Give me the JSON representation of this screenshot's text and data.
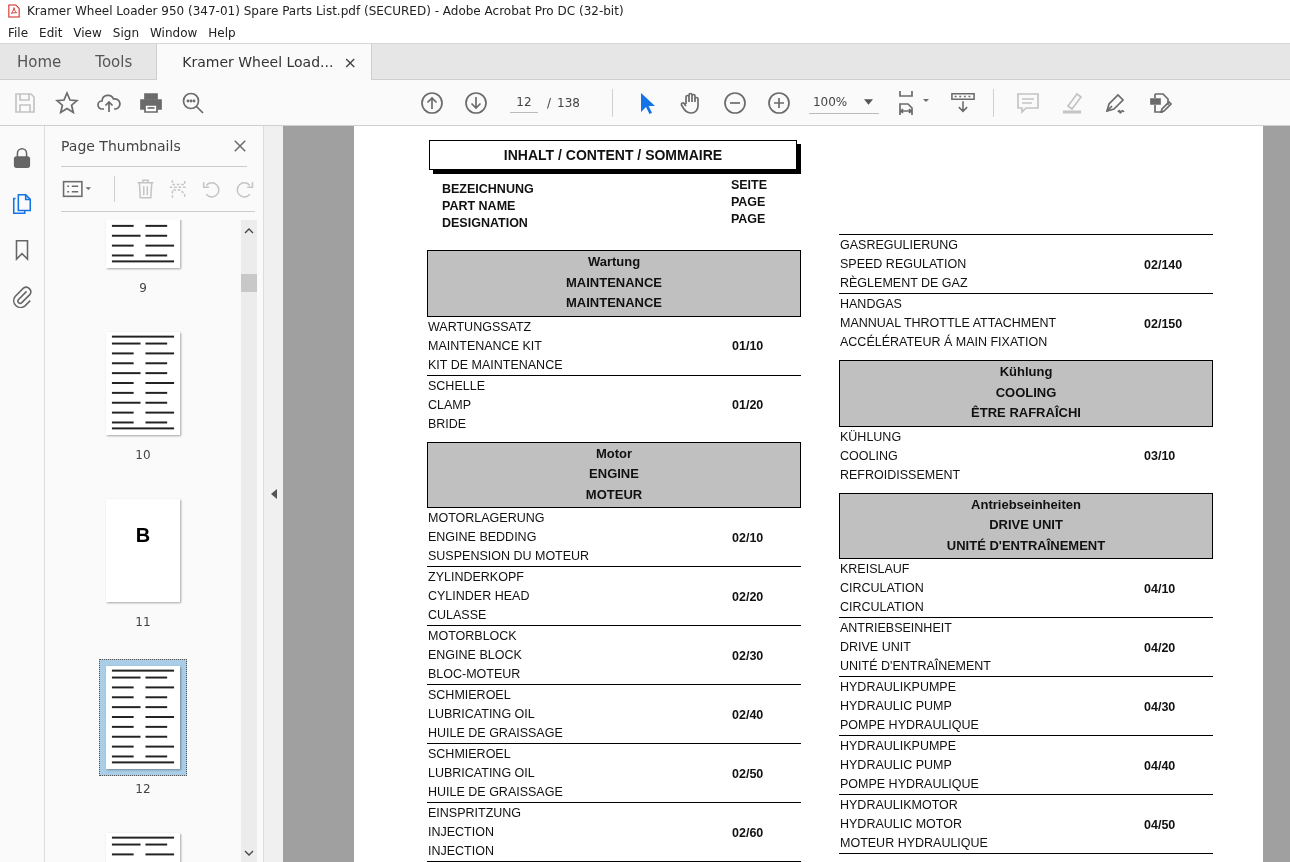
{
  "window": {
    "title": "Kramer Wheel Loader 950 (347-01) Spare Parts List.pdf (SECURED) - Adobe Acrobat Pro DC (32-bit)"
  },
  "menu": [
    "File",
    "Edit",
    "View",
    "Sign",
    "Window",
    "Help"
  ],
  "tabs": [
    {
      "label": "Home",
      "selected": false
    },
    {
      "label": "Tools",
      "selected": false
    },
    {
      "label": "Kramer Wheel Load...",
      "selected": true,
      "close": "×"
    }
  ],
  "toolbar": {
    "left_tools": [
      {
        "kind": "save",
        "disabled": true
      },
      {
        "kind": "star",
        "disabled": false
      },
      {
        "kind": "upload",
        "disabled": false
      },
      {
        "kind": "print",
        "disabled": false
      },
      {
        "kind": "find",
        "disabled": false
      }
    ],
    "page_current": "12",
    "page_separator": "/",
    "page_total": "138",
    "tools": [
      {
        "kind": "pointer",
        "selected": true
      },
      {
        "kind": "hand",
        "selected": false
      }
    ],
    "zoom": "100%",
    "right_tools": [
      {
        "kind": "comment",
        "disabled": true
      },
      {
        "kind": "highlight",
        "disabled": true
      },
      {
        "kind": "sign",
        "disabled": false
      },
      {
        "kind": "form",
        "disabled": false
      }
    ]
  },
  "rail": [
    {
      "kind": "lock",
      "selected": false
    },
    {
      "kind": "pages",
      "selected": true
    },
    {
      "kind": "bookmark",
      "selected": false
    },
    {
      "kind": "attachment",
      "selected": false
    }
  ],
  "panel": {
    "title": "Page Thumbnails",
    "tools": [
      {
        "kind": "delete",
        "disabled": true
      },
      {
        "kind": "insert",
        "disabled": true
      },
      {
        "kind": "rotate_left",
        "disabled": true
      },
      {
        "kind": "rotate_right",
        "disabled": true
      }
    ],
    "thumbnails": [
      {
        "label": "9",
        "selected": false
      },
      {
        "label": "10",
        "selected": false
      },
      {
        "label": "11",
        "selected": false,
        "letter": "B"
      },
      {
        "label": "12",
        "selected": true
      },
      {
        "selected": false
      }
    ]
  },
  "document": {
    "title": "INHALT / CONTENT / SOMMAIRE",
    "name_labels": [
      "BEZEICHNUNG",
      "PART NAME",
      "DESIGNATION"
    ],
    "page_labels": [
      "SEITE",
      "PAGE",
      "PAGE"
    ],
    "left_column": [
      {
        "kind": "section",
        "lines": [
          "Wartung",
          "MAINTENANCE",
          "MAINTENANCE"
        ]
      },
      {
        "kind": "entry",
        "lines": [
          "WARTUNGSSATZ",
          "MAINTENANCE KIT",
          "KIT DE MAINTENANCE"
        ],
        "page": "01/10"
      },
      {
        "kind": "entry",
        "lines": [
          "SCHELLE",
          "CLAMP",
          "BRIDE"
        ],
        "page": "01/20"
      },
      {
        "kind": "section",
        "lines": [
          "Motor",
          "ENGINE",
          "MOTEUR"
        ]
      },
      {
        "kind": "entry",
        "lines": [
          "MOTORLAGERUNG",
          "ENGINE BEDDING",
          "SUSPENSION DU MOTEUR"
        ],
        "page": "02/10"
      },
      {
        "kind": "entry",
        "lines": [
          "ZYLINDERKOPF",
          "CYLINDER HEAD",
          "CULASSE"
        ],
        "page": "02/20"
      },
      {
        "kind": "entry",
        "lines": [
          "MOTORBLOCK",
          "ENGINE BLOCK",
          "BLOC-MOTEUR"
        ],
        "page": "02/30"
      },
      {
        "kind": "entry",
        "lines": [
          "SCHMIEROEL",
          "LUBRICATING OIL",
          "HUILE DE GRAISSAGE"
        ],
        "page": "02/40"
      },
      {
        "kind": "entry",
        "lines": [
          "SCHMIEROEL",
          "LUBRICATING OIL",
          "HUILE DE GRAISSAGE"
        ],
        "page": "02/50"
      },
      {
        "kind": "entry",
        "lines": [
          "EINSPRITZUNG",
          "INJECTION",
          "INJECTION"
        ],
        "page": "02/60"
      }
    ],
    "right_column": [
      {
        "kind": "entry",
        "lines": [
          "GASREGULIERUNG",
          "SPEED REGULATION",
          "RÈGLEMENT DE GAZ"
        ],
        "page": "02/140"
      },
      {
        "kind": "entry",
        "lines": [
          "HANDGAS",
          "MANNUAL THROTTLE ATTACHMENT",
          "ACCÉLÉRATEUR Á MAIN FIXATION"
        ],
        "page": "02/150"
      },
      {
        "kind": "section",
        "lines": [
          "Kühlung",
          "COOLING",
          "ÊTRE RAFRAÎCHI"
        ]
      },
      {
        "kind": "entry",
        "lines": [
          "KÜHLUNG",
          "COOLING",
          "REFROIDISSEMENT"
        ],
        "page": "03/10"
      },
      {
        "kind": "section",
        "lines": [
          "Antriebseinheiten",
          "DRIVE UNIT",
          "UNITÉ D'ENTRAÎNEMENT"
        ]
      },
      {
        "kind": "entry",
        "lines": [
          "KREISLAUF",
          "CIRCULATION",
          "CIRCULATION"
        ],
        "page": "04/10"
      },
      {
        "kind": "entry",
        "lines": [
          "ANTRIEBSEINHEIT",
          "DRIVE UNIT",
          "UNITÉ D'ENTRAÎNEMENT"
        ],
        "page": "04/20"
      },
      {
        "kind": "entry",
        "lines": [
          "HYDRAULIKPUMPE",
          "HYDRAULIC PUMP",
          "POMPE HYDRAULIQUE"
        ],
        "page": "04/30"
      },
      {
        "kind": "entry",
        "lines": [
          "HYDRAULIKPUMPE",
          "HYDRAULIC PUMP",
          "POMPE HYDRAULIQUE"
        ],
        "page": "04/40"
      },
      {
        "kind": "entry",
        "lines": [
          "HYDRAULIKMOTOR",
          "HYDRAULIC MOTOR",
          "MOTEUR HYDRAULIQUE"
        ],
        "page": "04/50"
      }
    ]
  }
}
